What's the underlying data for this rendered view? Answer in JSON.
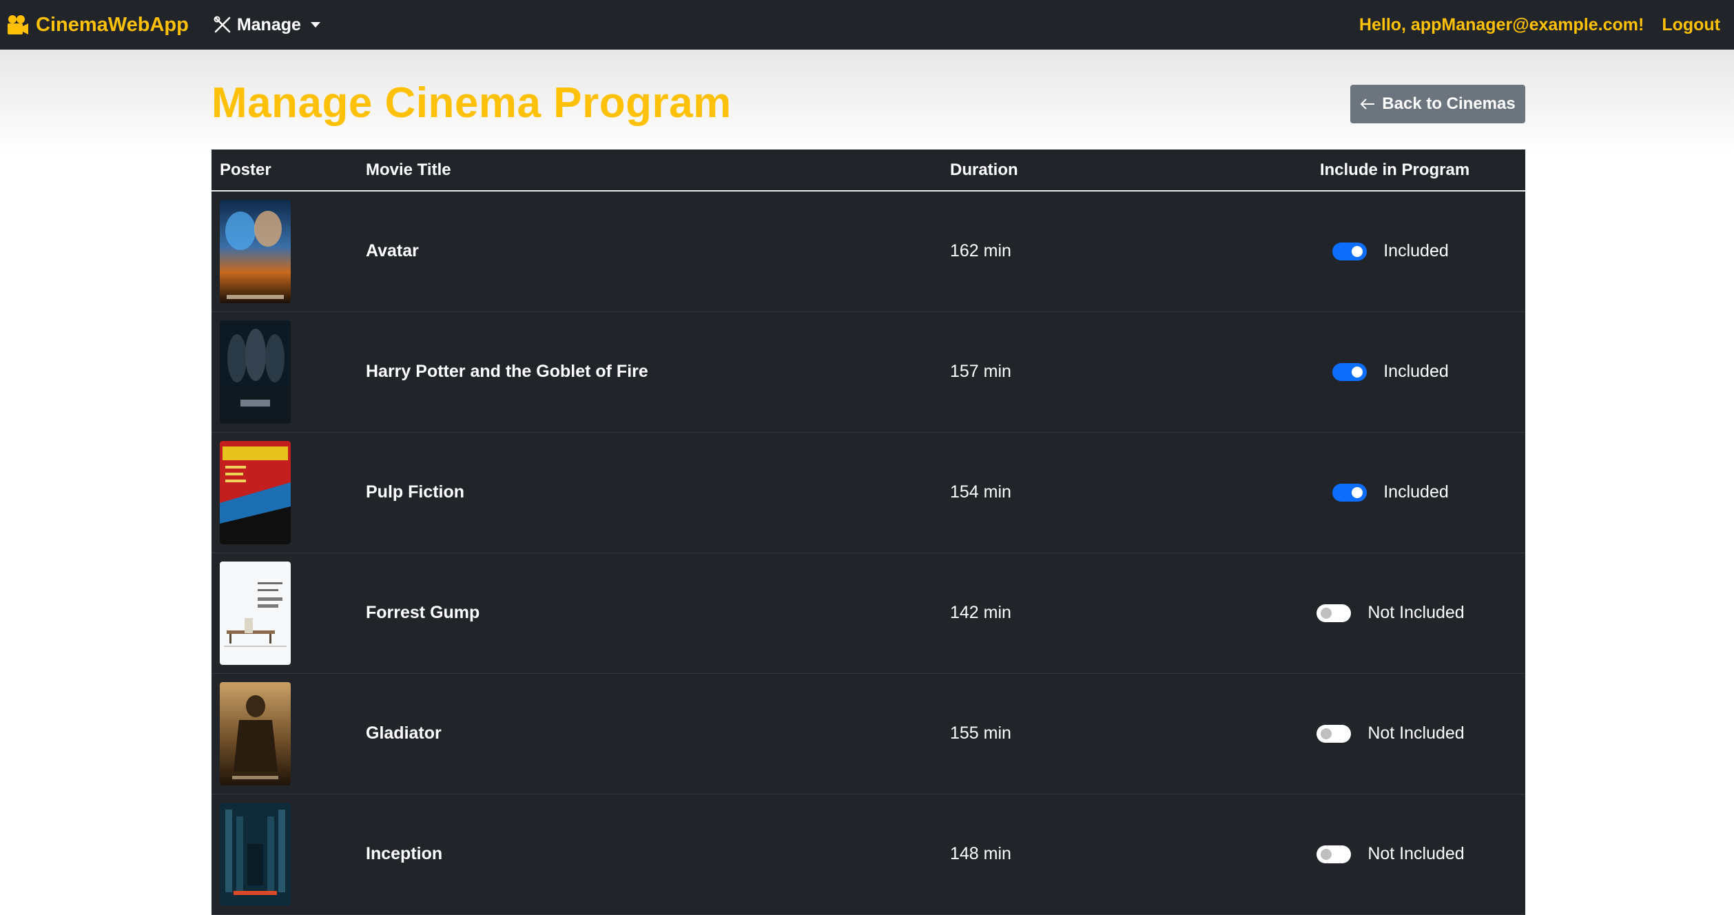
{
  "navbar": {
    "brand": "CinemaWebApp",
    "manage_label": "Manage",
    "greeting": "Hello, appManager@example.com!",
    "logout_label": "Logout"
  },
  "page": {
    "title": "Manage Cinema Program",
    "back_label": "Back to Cinemas"
  },
  "table": {
    "headers": {
      "poster": "Poster",
      "title": "Movie Title",
      "duration": "Duration",
      "include": "Include in Program"
    },
    "rows": [
      {
        "title": "Avatar",
        "duration": "162 min",
        "included": true,
        "status": "Included",
        "poster_icon": "avatar-poster"
      },
      {
        "title": "Harry Potter and the Goblet of Fire",
        "duration": "157 min",
        "included": true,
        "status": "Included",
        "poster_icon": "harry-potter-poster"
      },
      {
        "title": "Pulp Fiction",
        "duration": "154 min",
        "included": true,
        "status": "Included",
        "poster_icon": "pulp-fiction-poster"
      },
      {
        "title": "Forrest Gump",
        "duration": "142 min",
        "included": false,
        "status": "Not Included",
        "poster_icon": "forrest-gump-poster"
      },
      {
        "title": "Gladiator",
        "duration": "155 min",
        "included": false,
        "status": "Not Included",
        "poster_icon": "gladiator-poster"
      },
      {
        "title": "Inception",
        "duration": "148 min",
        "included": false,
        "status": "Not Included",
        "poster_icon": "inception-poster"
      }
    ]
  },
  "colors": {
    "navbar_bg": "#212529",
    "accent": "#ffc107",
    "switch_on": "#0d6efd",
    "back_button": "#6c757d"
  }
}
